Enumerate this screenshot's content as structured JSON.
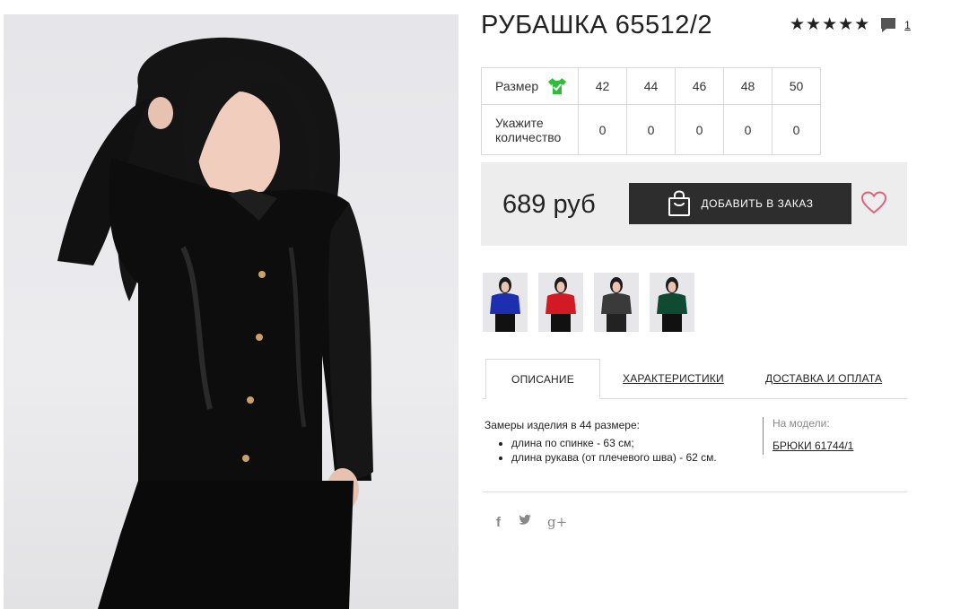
{
  "product": {
    "title": "РУБАШКА 65512/2",
    "rating_stars": "★★★★★",
    "reviews_count": "1"
  },
  "sizes": {
    "size_label": "Размер",
    "qty_label_line1": "Укажите",
    "qty_label_line2": "количество",
    "values": [
      "42",
      "44",
      "46",
      "48",
      "50"
    ],
    "quantities": [
      "0",
      "0",
      "0",
      "0",
      "0"
    ]
  },
  "buy": {
    "price": "689 руб",
    "add_button": "ДОБАВИТЬ В ЗАКАЗ"
  },
  "thumbnails": [
    {
      "color": "#1d2fb0",
      "name": "thumb-blue"
    },
    {
      "color": "#d11a24",
      "name": "thumb-red"
    },
    {
      "color": "#3a3a3a",
      "name": "thumb-black"
    },
    {
      "color": "#0f4a33",
      "name": "thumb-green"
    }
  ],
  "tabs": {
    "description": "ОПИСАНИЕ",
    "characteristics": "ХАРАКТЕРИСТИКИ",
    "delivery": "ДОСТАВКА И ОПЛАТА"
  },
  "description": {
    "intro": "Замеры изделия в 44 размере:",
    "items": [
      "длина по спинке - 63 см;",
      "длина рукава (от плечевого шва) - 62 см."
    ],
    "on_model_label": "На модели:",
    "on_model_link": "БРЮКИ 61744/1"
  },
  "social": {
    "facebook": "f",
    "twitter": "🐦",
    "googleplus": "g+"
  },
  "colors": {
    "accent_dark": "#2d2d2d",
    "heart": "#e0607e",
    "shirt_icon": "#2dbd3a"
  }
}
